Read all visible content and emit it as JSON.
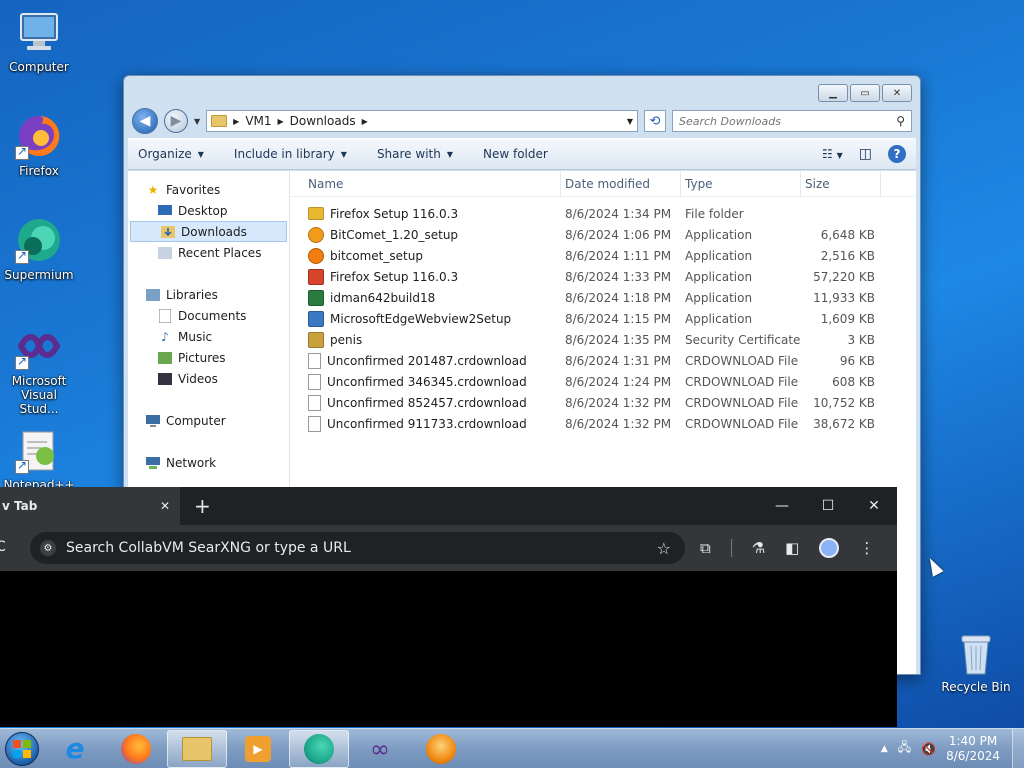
{
  "desktop": {
    "icons": [
      {
        "label": "Computer"
      },
      {
        "label": "Firefox"
      },
      {
        "label": "Supermium"
      },
      {
        "label": "Microsoft Visual Stud..."
      },
      {
        "label": "Notepad++"
      }
    ],
    "recycle_bin": "Recycle Bin"
  },
  "explorer": {
    "breadcrumb": [
      "VM1",
      "Downloads"
    ],
    "search_placeholder": "Search Downloads",
    "toolbar": {
      "organize": "Organize",
      "include_in_library": "Include in library",
      "share_with": "Share with",
      "new_folder": "New folder"
    },
    "nav": {
      "favorites": "Favorites",
      "desktop": "Desktop",
      "downloads": "Downloads",
      "recent_places": "Recent Places",
      "libraries": "Libraries",
      "documents": "Documents",
      "music": "Music",
      "pictures": "Pictures",
      "videos": "Videos",
      "computer": "Computer",
      "network": "Network"
    },
    "columns": {
      "name": "Name",
      "date": "Date modified",
      "type": "Type",
      "size": "Size"
    },
    "files": [
      {
        "name": "Firefox Setup 116.0.3",
        "date": "8/6/2024 1:34 PM",
        "type": "File folder",
        "size": "",
        "icon": "folder-icon",
        "color": "#e8b830"
      },
      {
        "name": "BitComet_1.20_setup",
        "date": "8/6/2024 1:06 PM",
        "type": "Application",
        "size": "6,648 KB",
        "icon": "bitcomet-icon",
        "color": "#f29b1d"
      },
      {
        "name": "bitcomet_setup",
        "date": "8/6/2024 1:11 PM",
        "type": "Application",
        "size": "2,516 KB",
        "icon": "bitcomet-icon",
        "color": "#f07f0f"
      },
      {
        "name": "Firefox Setup 116.0.3",
        "date": "8/6/2024 1:33 PM",
        "type": "Application",
        "size": "57,220 KB",
        "icon": "firefox-installer-icon",
        "color": "#d6452b"
      },
      {
        "name": "idman642build18",
        "date": "8/6/2024 1:18 PM",
        "type": "Application",
        "size": "11,933 KB",
        "icon": "idm-icon",
        "color": "#2b7a3f"
      },
      {
        "name": "MicrosoftEdgeWebview2Setup",
        "date": "8/6/2024 1:15 PM",
        "type": "Application",
        "size": "1,609 KB",
        "icon": "installer-icon",
        "color": "#3b78c4"
      },
      {
        "name": "penis",
        "date": "8/6/2024 1:35 PM",
        "type": "Security Certificate",
        "size": "3 KB",
        "icon": "certificate-icon",
        "color": "#c9a13a"
      },
      {
        "name": "Unconfirmed 201487.crdownload",
        "date": "8/6/2024 1:31 PM",
        "type": "CRDOWNLOAD File",
        "size": "96 KB",
        "icon": "blank-file-icon",
        "color": "#ffffff"
      },
      {
        "name": "Unconfirmed 346345.crdownload",
        "date": "8/6/2024 1:24 PM",
        "type": "CRDOWNLOAD File",
        "size": "608 KB",
        "icon": "blank-file-icon",
        "color": "#ffffff"
      },
      {
        "name": "Unconfirmed 852457.crdownload",
        "date": "8/6/2024 1:32 PM",
        "type": "CRDOWNLOAD File",
        "size": "10,752 KB",
        "icon": "blank-file-icon",
        "color": "#ffffff"
      },
      {
        "name": "Unconfirmed 911733.crdownload",
        "date": "8/6/2024 1:32 PM",
        "type": "CRDOWNLOAD File",
        "size": "38,672 KB",
        "icon": "blank-file-icon",
        "color": "#ffffff"
      }
    ]
  },
  "browser": {
    "tab_title": "v Tab",
    "omnibox_placeholder": "Search CollabVM SearXNG or type a URL"
  },
  "taskbar": {
    "time": "1:40 PM",
    "date": "8/6/2024"
  }
}
